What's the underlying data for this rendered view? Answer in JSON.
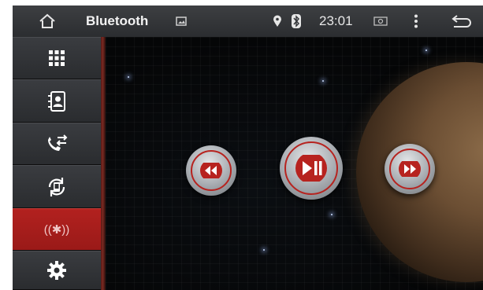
{
  "status_bar": {
    "title": "Bluetooth",
    "time": "23:01",
    "icons": [
      "home-icon",
      "image-icon",
      "location-icon",
      "bluetooth-icon",
      "battery-icon",
      "menu-dots-icon",
      "back-icon"
    ]
  },
  "sidebar": {
    "items": [
      {
        "icon": "apps-grid-icon",
        "active": false
      },
      {
        "icon": "contacts-icon",
        "active": false
      },
      {
        "icon": "call-transfer-icon",
        "active": false
      },
      {
        "icon": "phone-sync-icon",
        "active": false
      },
      {
        "icon": "bluetooth-audio-icon",
        "active": true,
        "label": "((✱))"
      },
      {
        "icon": "settings-gear-icon",
        "active": false
      }
    ]
  },
  "player": {
    "controls": [
      "rewind-icon",
      "play-pause-icon",
      "fast-forward-icon"
    ]
  },
  "colors": {
    "accent_red": "#b2211f",
    "status_bar": "#35373a",
    "background": "#050607"
  }
}
